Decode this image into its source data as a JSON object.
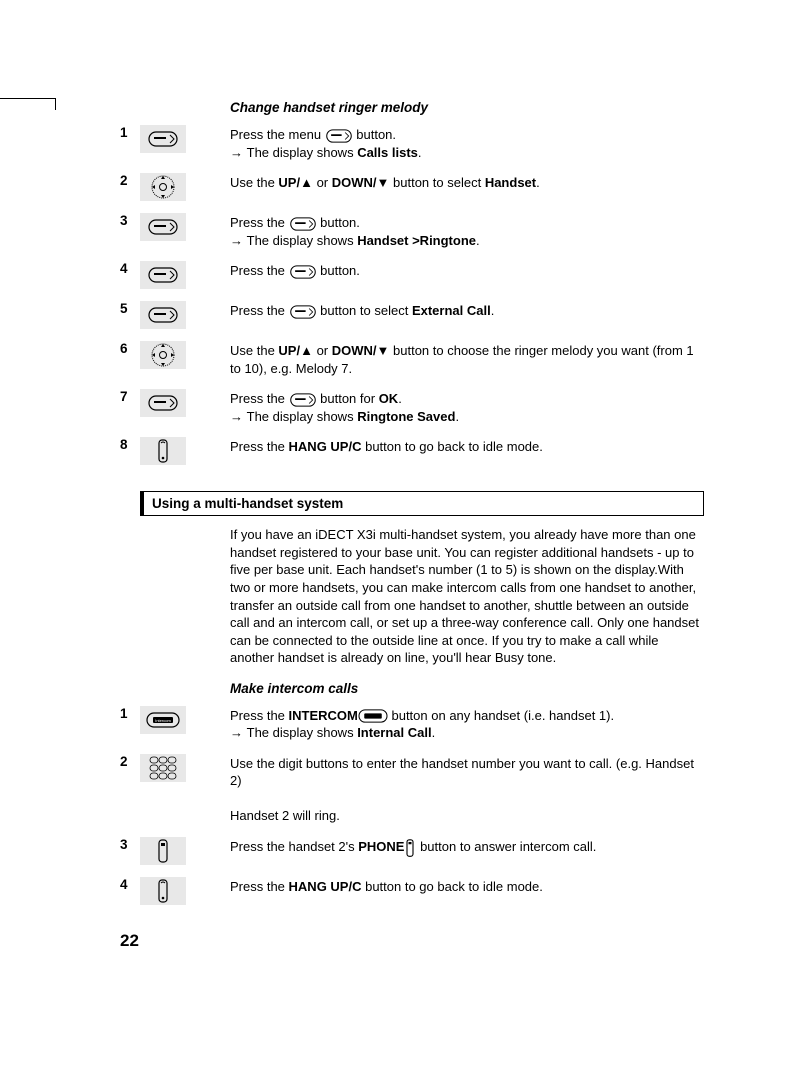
{
  "section1": {
    "title": "Change handset ringer melody",
    "steps": [
      {
        "num": "1",
        "icon": "menu-button",
        "text_before": "Press the menu ",
        "text_after": " button.",
        "result_prefix": "→ ",
        "result": "The display shows ",
        "result_bold": "Calls lists",
        "result_end": "."
      },
      {
        "num": "2",
        "icon": "nav-pad",
        "line": "Use the ",
        "b1": "UP/▲",
        "mid1": " or ",
        "b2": "DOWN/▼",
        "mid2": " button to select ",
        "b3": "Handset",
        "end": "."
      },
      {
        "num": "3",
        "icon": "menu-button",
        "text_before": "Press the ",
        "text_after": " button.",
        "result_prefix": "→ ",
        "result": "The display shows ",
        "result_bold": "Handset >Ringtone",
        "result_end": "."
      },
      {
        "num": "4",
        "icon": "menu-button",
        "text_before": "Press the ",
        "text_after": " button."
      },
      {
        "num": "5",
        "icon": "menu-button",
        "text_before": "Press the ",
        "text_after": " button  to select ",
        "b_tail": "External Call",
        "end": "."
      },
      {
        "num": "6",
        "icon": "nav-pad",
        "line": "Use the ",
        "b1": "UP/▲",
        "mid1": " or ",
        "b2": "DOWN/▼",
        "mid2": " button to choose the ringer melody you want (from 1 to 10), e.g. Melody 7."
      },
      {
        "num": "7",
        "icon": "menu-button",
        "text_before": "Press the ",
        "text_after": " button for ",
        "b_tail": "OK",
        "end": ".",
        "result_prefix": "→ ",
        "result": "The display shows ",
        "result_bold": "Ringtone Saved",
        "result_end": "."
      },
      {
        "num": "8",
        "icon": "hangup",
        "line": "Press the ",
        "b1": "HANG UP/C",
        "mid1": " button to go back to idle mode."
      }
    ]
  },
  "box_heading": "Using a multi-handset system",
  "intro_para": "If you have an iDECT X3i multi-handset system, you already have more than one handset registered to your base unit. You can register additional handsets - up to five per base unit. Each handset's number (1 to 5) is shown on the display.With two or more handsets, you can make intercom calls from one handset to another, transfer an outside call from one handset to another, shuttle between an outside call and an intercom call, or set up a three-way conference call. Only one handset can be connected to the outside line at once. If you try to make a call while another handset is already on line, you'll hear Busy tone.",
  "section2": {
    "title": "Make intercom calls",
    "steps": [
      {
        "num": "1",
        "icon": "intercom",
        "line": "Press the ",
        "b1": "INTERCOM",
        "mid1_icon": "intercom-inline",
        "mid1": " button on any handset (i.e. handset 1).",
        "result_prefix": "→ ",
        "result": "The display shows ",
        "result_bold": "Internal Call",
        "result_end": "."
      },
      {
        "num": "2",
        "icon": "keypad",
        "line": "Use the digit buttons to enter the handset number you want to call. (e.g. Handset 2)",
        "extra": "Handset 2 will ring."
      },
      {
        "num": "3",
        "icon": "phone",
        "line": "Press the handset 2's  ",
        "b1": "PHONE",
        "mid1_icon": "phone-inline",
        "mid1": " button to answer intercom call."
      },
      {
        "num": "4",
        "icon": "hangup",
        "line": "Press the ",
        "b1": "HANG UP/C",
        "mid1": " button to go back to idle mode."
      }
    ]
  },
  "page_number": "22"
}
